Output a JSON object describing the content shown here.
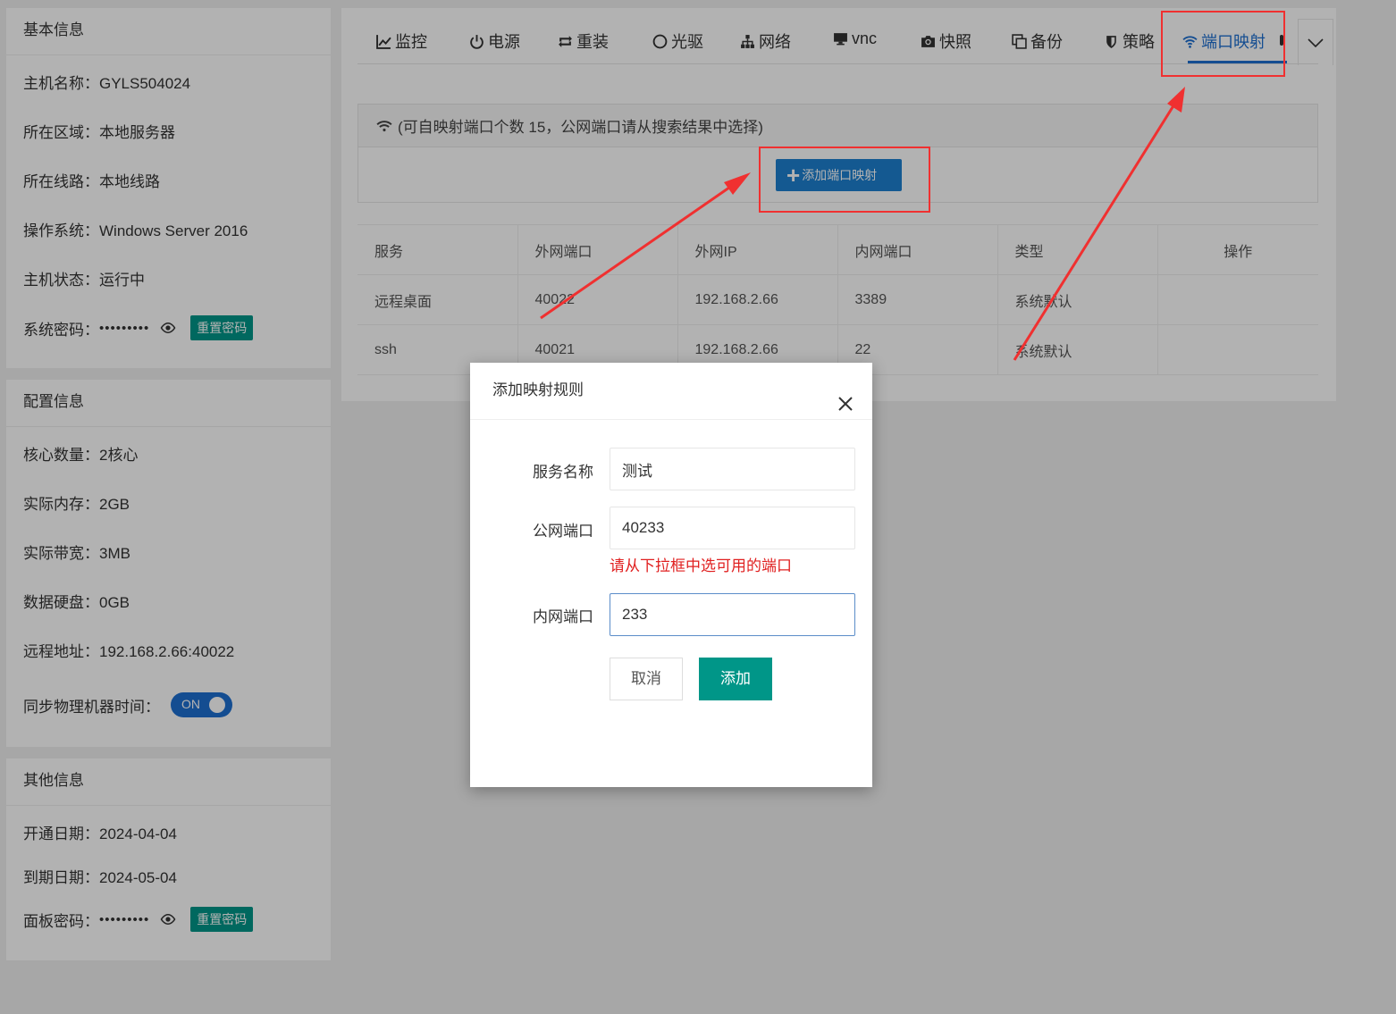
{
  "basic": {
    "title": "基本信息",
    "rows": [
      "主机名称：GYLS504024",
      "所在区域：本地服务器",
      "所在线路：本地线路",
      "操作系统：Windows Server 2016",
      "主机状态：运行中"
    ],
    "password_label": "系统密码：",
    "password_mask": "•••••••••",
    "reset_label": "重置密码"
  },
  "config": {
    "title": "配置信息",
    "rows": [
      "核心数量：2核心",
      "实际内存：2GB",
      "实际带宽：3MB",
      "数据硬盘：0GB",
      "远程地址：192.168.2.66:40022"
    ],
    "sync_label": "同步物理机器时间：",
    "toggle_label": "ON"
  },
  "other": {
    "title": "其他信息",
    "rows": [
      "开通日期：2024-04-04",
      "到期日期：2024-05-04"
    ],
    "password_label": "面板密码：",
    "password_mask": "•••••••••",
    "reset_label": "重置密码"
  },
  "tabs": [
    "监控",
    "电源",
    "重装",
    "光驱",
    "网络",
    "vnc",
    "快照",
    "备份",
    "策略",
    "端口映射"
  ],
  "active_tab": "端口映射",
  "info": {
    "text": "(可自映射端口个数 15，公网端口请从搜索结果中选择)",
    "add_button": "添加端口映射"
  },
  "table": {
    "headers": [
      "服务",
      "外网端口",
      "外网IP",
      "内网端口",
      "类型",
      "操作"
    ],
    "rows": [
      [
        "远程桌面",
        "40022",
        "192.168.2.66",
        "3389",
        "系统默认",
        ""
      ],
      [
        "ssh",
        "40021",
        "192.168.2.66",
        "22",
        "系统默认",
        ""
      ]
    ]
  },
  "modal": {
    "title": "添加映射规则",
    "service_label": "服务名称",
    "service_value": "测试",
    "public_label": "公网端口",
    "public_value": "40233",
    "error": "请从下拉框中选可用的端口",
    "private_label": "内网端口",
    "private_value": "233",
    "cancel": "取消",
    "submit": "添加"
  },
  "colors": {
    "accent_blue": "#1e6fd0",
    "teal": "#009688",
    "annotation_red": "#f03030",
    "error_red": "#e02020"
  }
}
